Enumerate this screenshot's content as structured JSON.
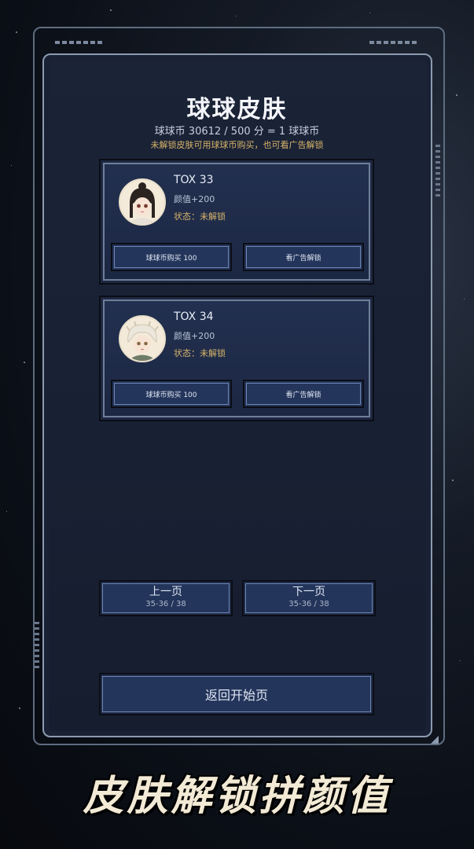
{
  "header": {
    "title": "球球皮肤",
    "coins_line": "球球币 30612 / 500 分 = 1 球球币",
    "hint": "未解锁皮肤可用球球币购买，也可看广告解锁"
  },
  "skins": [
    {
      "name": "TOX 33",
      "attr": "颜值+200",
      "status": "状态：未解锁",
      "buy_label": "球球币购买 100",
      "ad_label": "看广告解锁"
    },
    {
      "name": "TOX 34",
      "attr": "颜值+200",
      "status": "状态：未解锁",
      "buy_label": "球球币购买 100",
      "ad_label": "看广告解锁"
    }
  ],
  "pagination": {
    "prev_label": "上一页",
    "next_label": "下一页",
    "range": "35-36 / 38"
  },
  "footer": {
    "home_label": "返回开始页",
    "slogan": "皮肤解锁拼颜值"
  },
  "colors": {
    "accent_gold": "#d8b56a",
    "panel_bg": "#1a2134",
    "button_bg": "#24355b"
  }
}
